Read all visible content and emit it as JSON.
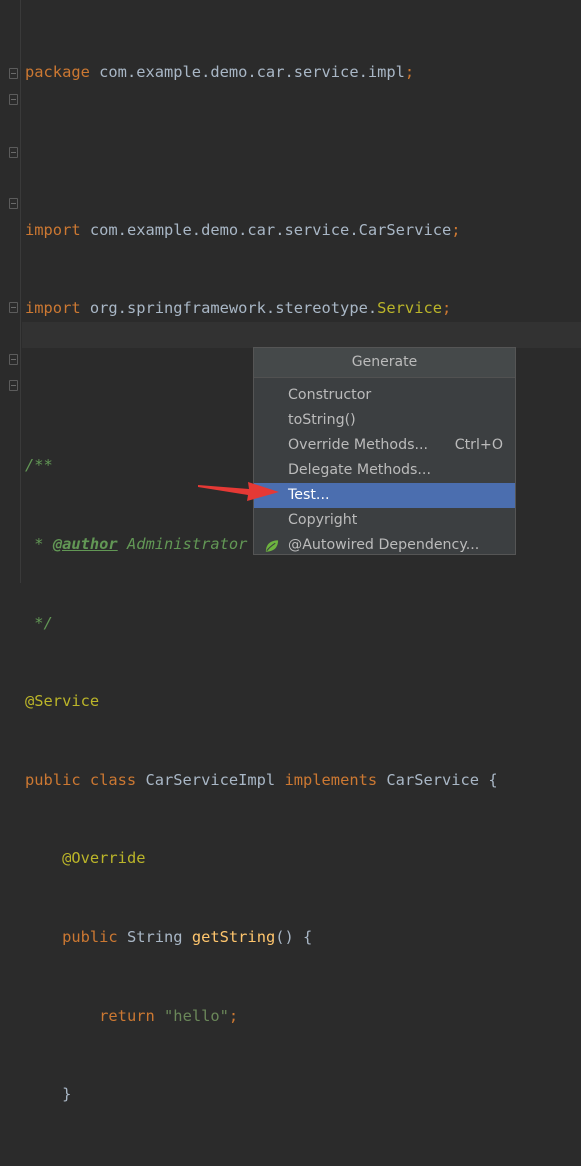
{
  "code": {
    "l1_kw": "package",
    "l1_rest": " com.example.demo.car.service.impl",
    "semi": ";",
    "l3_kw": "import",
    "l3_path": " com.example.demo.car.service.",
    "l3_cls": "CarService",
    "l4_kw": "import",
    "l4_path": " org.springframework.stereotype.",
    "l4_cls": "Service",
    "l6": "/**",
    "l7_star": " * ",
    "l7_tag": "@author",
    "l7_rest": " Administrator",
    "l8": " */",
    "l9": "@Service",
    "l10_kw1": "public class",
    "l10_name": " CarServiceImpl ",
    "l10_kw2": "implements",
    "l10_rest": " CarService {",
    "l11": "@Override",
    "l12_kw": "public",
    "l12_type": " String ",
    "l12_fn": "getString",
    "l12_rest": "() {",
    "l13_kw": "return",
    "l13_str": "\"hello\"",
    "l14": "}",
    "l15": "}"
  },
  "popup": {
    "title": "Generate",
    "items": [
      {
        "label": "Constructor",
        "shortcut": ""
      },
      {
        "label": "toString()",
        "shortcut": ""
      },
      {
        "label": "Override Methods...",
        "shortcut": "Ctrl+O"
      },
      {
        "label": "Delegate Methods...",
        "shortcut": ""
      },
      {
        "label": "Test...",
        "shortcut": ""
      },
      {
        "label": "Copyright",
        "shortcut": ""
      },
      {
        "label": "@Autowired Dependency...",
        "shortcut": "",
        "icon": "spring-leaf-icon"
      }
    ],
    "selected_index": 4
  },
  "colors": {
    "background": "#2b2b2b",
    "keyword": "#cc7832",
    "string": "#6a8759",
    "annotation": "#bbb529",
    "selection": "#4b6eaf",
    "arrow": "#e53935"
  }
}
